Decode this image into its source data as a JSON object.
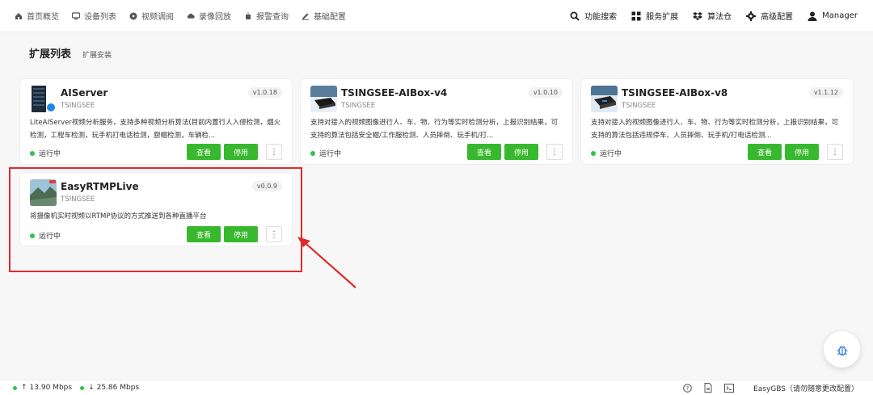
{
  "nav": {
    "left": [
      {
        "label": "首页概览",
        "icon": "home-icon"
      },
      {
        "label": "设备列表",
        "icon": "screen-icon"
      },
      {
        "label": "视频调阅",
        "icon": "play-circle-icon"
      },
      {
        "label": "录像回放",
        "icon": "cloud-icon"
      },
      {
        "label": "报警查询",
        "icon": "alarm-icon"
      },
      {
        "label": "基础配置",
        "icon": "edit-icon"
      }
    ],
    "right": [
      {
        "label": "功能搜索",
        "icon": "search-icon"
      },
      {
        "label": "服务扩展",
        "icon": "grid-icon"
      },
      {
        "label": "算法仓",
        "icon": "dropbox-icon"
      },
      {
        "label": "高级配置",
        "icon": "gear-icon"
      },
      {
        "label": "Manager",
        "icon": "user-icon"
      }
    ]
  },
  "page": {
    "title": "扩展列表",
    "tab": "扩展安装"
  },
  "cards": [
    {
      "name": "AIServer",
      "vendor": "TSINGSEE",
      "version": "v1.0.18",
      "description": "LiteAIServer视频分析服务，支持多种视频分析算法(目前内置行人入侵检测，烟火检测，工程车检测，玩手机打电话检测，厨帽检测，车辆检...",
      "status": "运行中",
      "view_label": "查看",
      "stop_label": "停用",
      "more_label": "⋮"
    },
    {
      "name": "TSINGSEE-AIBox-v4",
      "vendor": "TSINGSEE",
      "version": "v1.0.10",
      "description": "支持对接入的视频图像进行人、车、物、行为等实时检测分析，上报识别结果，可支持的算法包括安全帽/工作服检测、人员摔倒、玩手机/打...",
      "status": "运行中",
      "view_label": "查看",
      "stop_label": "停用",
      "more_label": "⋮"
    },
    {
      "name": "TSINGSEE-AIBox-v8",
      "vendor": "TSINGSEE",
      "version": "v1.1.12",
      "description": "支持对接入的视频图像进行人、车、物、行为等实时检测分析，上报识别结果，可支持的算法包括违规停车、人员摔倒、玩手机/打电话检测...",
      "status": "运行中",
      "view_label": "查看",
      "stop_label": "停用",
      "more_label": "⋮"
    },
    {
      "name": "EasyRTMPLive",
      "vendor": "TSINGSEE",
      "version": "v0.0.9",
      "description": "将摄像机实时视频以RTMP协议的方式推送到各种直播平台",
      "status": "运行中",
      "view_label": "查看",
      "stop_label": "停用",
      "more_label": "⋮"
    }
  ],
  "statusbar": {
    "up": "13.90 Mbps",
    "down": "25.86 Mbps",
    "server_text": "EasyGBS（请勿随意更改配置）"
  },
  "colors": {
    "accent": "#38b82e",
    "running": "#35c24a",
    "highlight": "#e02a2a"
  }
}
